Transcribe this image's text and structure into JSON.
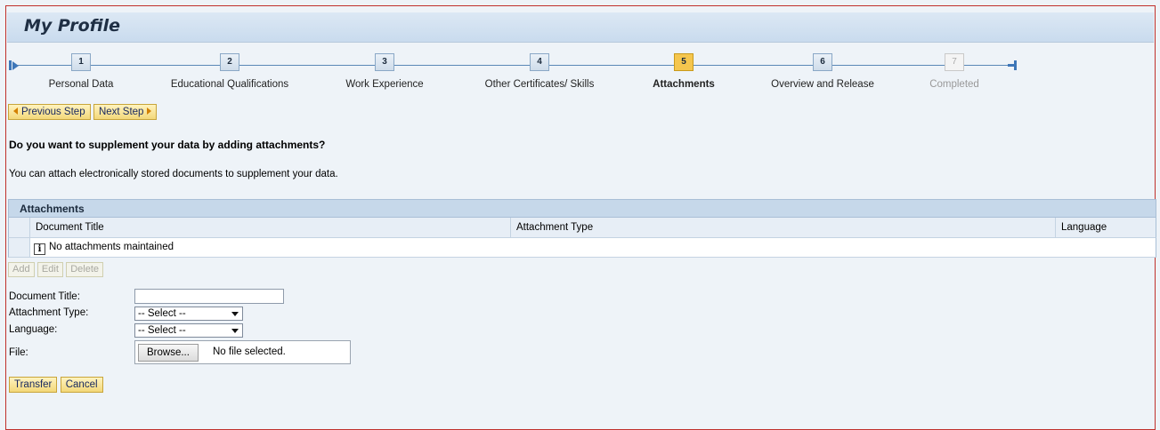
{
  "page": {
    "title": "My Profile"
  },
  "roadmap": {
    "steps": [
      {
        "number": "1",
        "label": "Personal Data",
        "state": "done"
      },
      {
        "number": "2",
        "label": "Educational Qualifications",
        "state": "done"
      },
      {
        "number": "3",
        "label": "Work Experience",
        "state": "done"
      },
      {
        "number": "4",
        "label": "Other Certificates/ Skills",
        "state": "done"
      },
      {
        "number": "5",
        "label": "Attachments",
        "state": "current"
      },
      {
        "number": "6",
        "label": "Overview and Release",
        "state": "done"
      },
      {
        "number": "7",
        "label": "Completed",
        "state": "disabled"
      }
    ]
  },
  "nav": {
    "previous_label": "Previous Step",
    "next_label": "Next Step"
  },
  "content": {
    "question": "Do you want to supplement your data by adding attachments?",
    "info": "You can attach electronically stored documents to supplement your data."
  },
  "attachments_table": {
    "title": "Attachments",
    "columns": [
      "Document Title",
      "Attachment Type",
      "Language"
    ],
    "empty_message": "No attachments maintained"
  },
  "table_actions": {
    "add_label": "Add",
    "edit_label": "Edit",
    "delete_label": "Delete"
  },
  "form": {
    "document_title_label": "Document Title:",
    "document_title_value": "",
    "attachment_type_label": "Attachment Type:",
    "attachment_type_value": "-- Select --",
    "language_label": "Language:",
    "language_value": "-- Select --",
    "file_label": "File:",
    "browse_label": "Browse...",
    "file_status": "No file selected."
  },
  "actions": {
    "transfer_label": "Transfer",
    "cancel_label": "Cancel"
  },
  "colors": {
    "accent_current_step": "#f5c64e",
    "button_yellow": "#f3d87a",
    "frame_border": "#c0302b"
  }
}
